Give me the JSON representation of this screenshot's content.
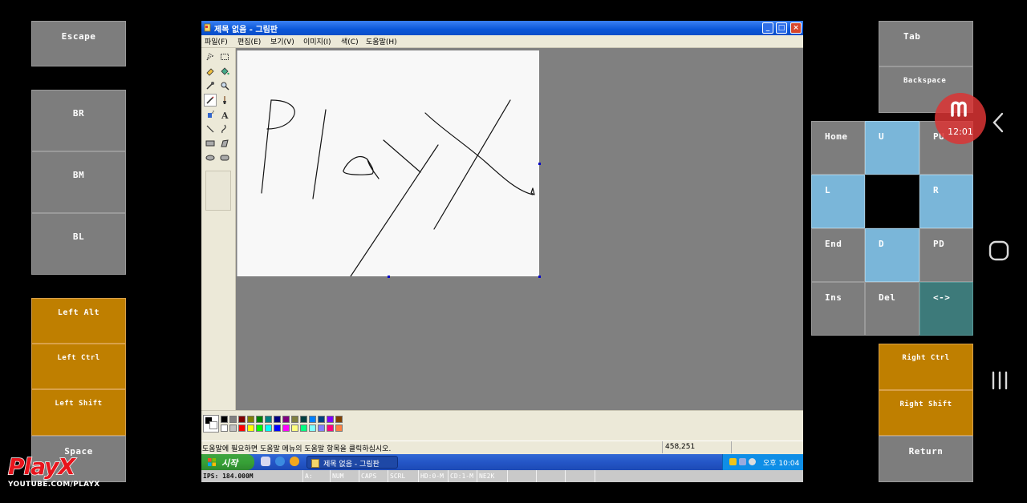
{
  "left_keys": {
    "escape": "Escape",
    "br": "BR",
    "bm": "BM",
    "bl": "BL",
    "left_alt": "Left Alt",
    "left_ctrl": "Left Ctrl",
    "left_shift": "Left Shift",
    "space": "Space"
  },
  "right_keys": {
    "tab": "Tab",
    "backspace": "Backspace",
    "home": "Home",
    "up": "U",
    "page_up": "PU",
    "left": "L",
    "right": "R",
    "end": "End",
    "down": "D",
    "page_down": "PD",
    "insert": "Ins",
    "delete": "Del",
    "toggle": "<->",
    "right_ctrl": "Right Ctrl",
    "right_shift": "Right Shift",
    "return": "Return"
  },
  "paint_window": {
    "title": "제목 없음 - 그림판",
    "menu": [
      "파일(F)",
      "편집(E)",
      "보기(V)",
      "이미지(I)",
      "색(C)",
      "도움말(H)"
    ],
    "status_hint": "도움말에 필요하면 도움말 메뉴의 도움말 항목을 클릭하십시오.",
    "coordinates": "458,251",
    "palette_colors": [
      "#000000",
      "#808080",
      "#800000",
      "#808000",
      "#008000",
      "#008080",
      "#000080",
      "#800080",
      "#808040",
      "#004040",
      "#0080ff",
      "#004080",
      "#8000ff",
      "#804000",
      "#ffffff",
      "#c0c0c0",
      "#ff0000",
      "#ffff00",
      "#00ff00",
      "#00ffff",
      "#0000ff",
      "#ff00ff",
      "#ffff80",
      "#00ff80",
      "#80ffff",
      "#8080ff",
      "#ff0080",
      "#ff8040"
    ]
  },
  "taskbar": {
    "start_label": "시작",
    "task_button": "제목 없음 - 그림판",
    "clock": "오후 10:04"
  },
  "emulator_status": [
    "IPS: 184.000M",
    "A:",
    "NUM",
    "CAPS",
    "SCRL",
    "HD:0-M",
    "CD:1-M",
    "NE2K"
  ],
  "overlay": {
    "clock_bubble": "12:01",
    "logo_text": "PlayX",
    "logo_subtitle": "YOUTUBE.COM/PLAYX"
  }
}
